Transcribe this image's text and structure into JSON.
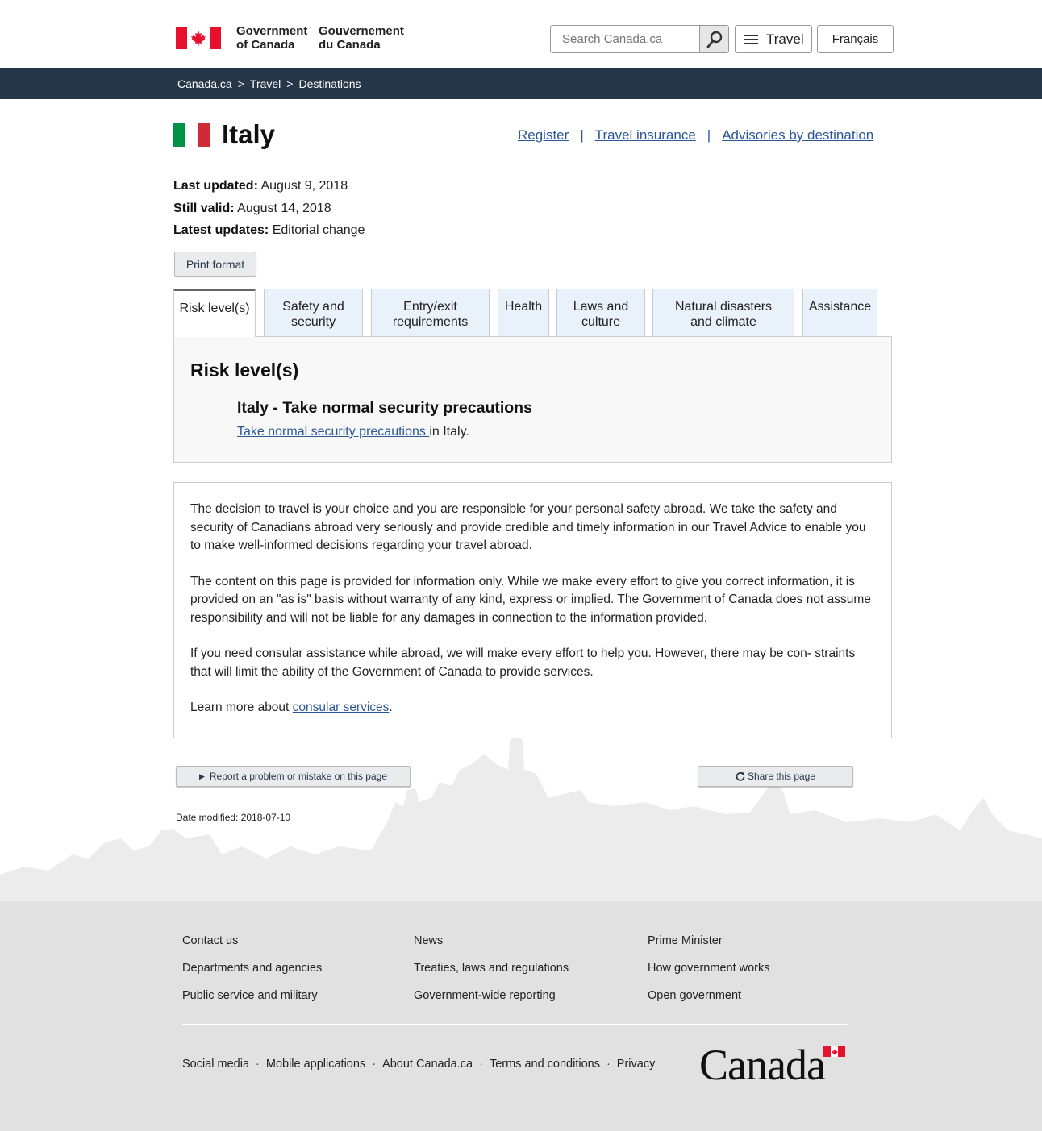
{
  "header": {
    "signature_en_line1": "Government",
    "signature_en_line2": "of Canada",
    "signature_fr_line1": "Gouvernement",
    "signature_fr_line2": "du Canada",
    "search_placeholder": "Search Canada.ca",
    "menu_label": "Travel",
    "language_toggle": "Français"
  },
  "breadcrumb": {
    "items": [
      "Canada.ca",
      "Travel",
      "Destinations"
    ],
    "separator": ">"
  },
  "page": {
    "title": "Italy",
    "flag_colors": [
      "#009246",
      "#ffffff",
      "#ce2b37"
    ],
    "top_links": [
      "Register",
      "Travel insurance",
      "Advisories by destination"
    ],
    "link_separator": "|",
    "meta": {
      "last_updated_label": "Last updated:",
      "last_updated_value": "August 9, 2018",
      "still_valid_label": "Still valid:",
      "still_valid_value": "August 14, 2018",
      "latest_updates_label": "Latest updates:",
      "latest_updates_value": "Editorial change"
    },
    "print_button": "Print format"
  },
  "tabs": [
    {
      "line1": "Risk level(s)",
      "line2": "",
      "active": true
    },
    {
      "line1": "Safety and",
      "line2": "security",
      "active": false
    },
    {
      "line1": "Entry/exit",
      "line2": "requirements",
      "active": false
    },
    {
      "line1": "Health",
      "line2": "",
      "active": false
    },
    {
      "line1": "Laws and",
      "line2": "culture",
      "active": false
    },
    {
      "line1": "Natural disasters",
      "line2": "and climate",
      "active": false
    },
    {
      "line1": "Assistance",
      "line2": "",
      "active": false
    }
  ],
  "risk_panel": {
    "heading": "Risk level(s)",
    "subheading": "Italy - Take normal security precautions",
    "link_text": "Take normal security precautions ",
    "trailing_text": "in Italy."
  },
  "disclaimer": {
    "para1": "The decision to travel is your choice and you are responsible for your personal safety abroad. We take the safety and security of Canadians abroad very seriously and provide credible and timely information in our Travel Advice to enable you to make well-informed decisions regarding your travel abroad.",
    "para2": "The content on this page is provided for information only. While we make every effort to give you correct information, it is provided on an \"as is\" basis without warranty of any kind, express or implied. The Government of Canada does not assume responsibility and will not be liable for any damages in connection to the information provided.",
    "para3": "If you need consular assistance while abroad, we will make every effort to help you. However, there may be con- straints that will limit the ability of the Government of Canada to provide services.",
    "learn_more_prefix": "Learn more about ",
    "learn_more_link": "consular services",
    "learn_more_suffix": "."
  },
  "actions": {
    "report_button": "Report a problem or mistake on this page",
    "share_button": "Share this page",
    "date_modified": "Date modified: 2018-07-10"
  },
  "footer": {
    "col1": [
      "Contact us",
      "Departments and agencies",
      "Public service and military"
    ],
    "col2": [
      "News",
      "Treaties, laws and regulations",
      "Government-wide reporting"
    ],
    "col3": [
      "Prime Minister",
      "How government works",
      "Open government"
    ],
    "bottom_links": [
      "Social media",
      "Mobile applications",
      "About Canada.ca",
      "Terms and conditions",
      "Privacy"
    ],
    "bottom_separator": "·",
    "wordmark": "Canada"
  },
  "colors": {
    "canada_red": "#e8112d",
    "breadcrumb_bar": "#26374a",
    "link": "#2b5797",
    "footer_bg": "#e1e1e1",
    "tab_bg": "#e9f1fb"
  }
}
